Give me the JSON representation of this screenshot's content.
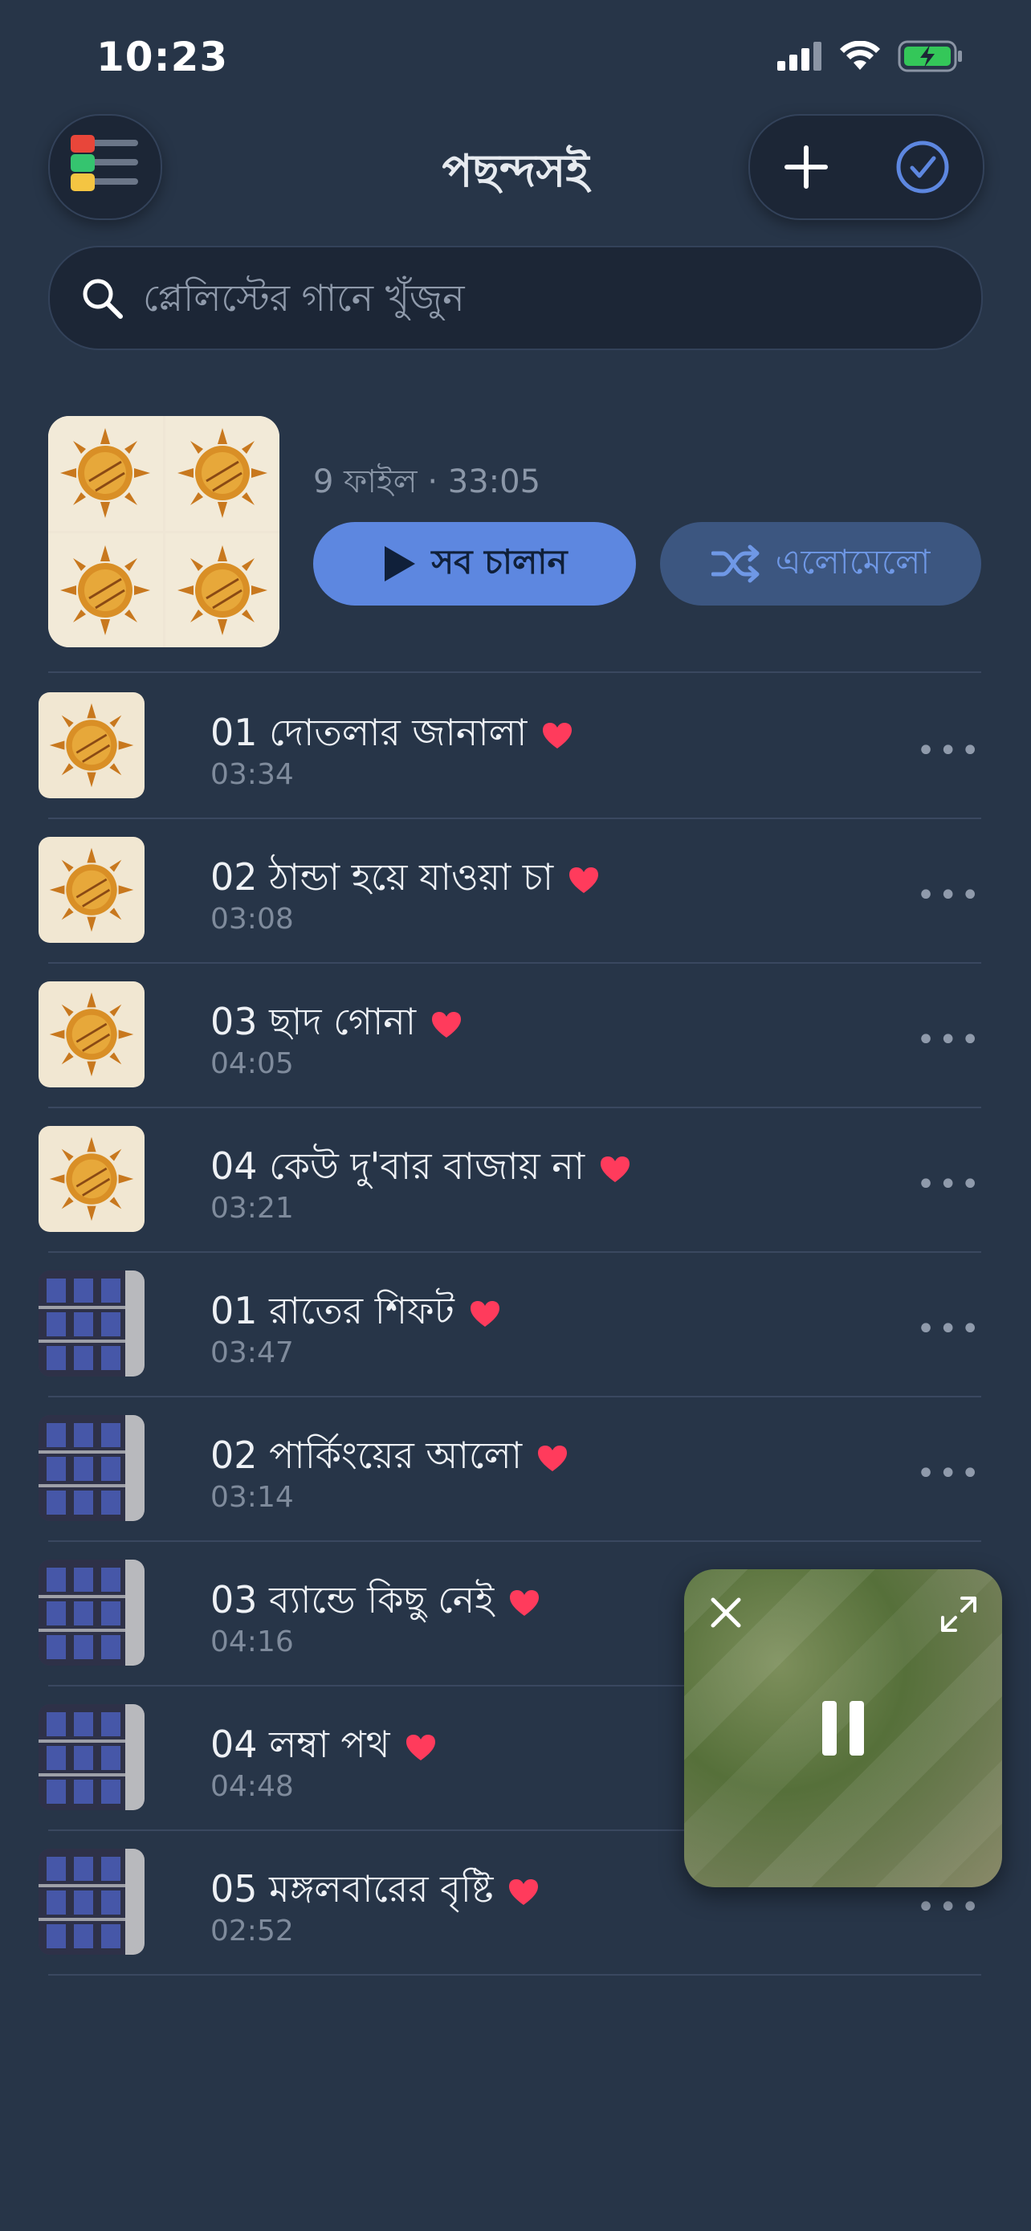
{
  "status": {
    "time": "10:23"
  },
  "header": {
    "title": "পছন্দসই"
  },
  "search": {
    "placeholder": "প্লেলিস্টের গানে খুঁজুন"
  },
  "playlist": {
    "meta": "9 ফাইল · 33:05",
    "play_all_label": "সব চালান",
    "shuffle_label": "এলোমেলো"
  },
  "songs": [
    {
      "title": "01 দোতলার জানালা",
      "duration": "03:34",
      "art": "sun",
      "favorite": true
    },
    {
      "title": "02 ঠান্ডা হয়ে যাওয়া চা",
      "duration": "03:08",
      "art": "sun",
      "favorite": true
    },
    {
      "title": "03 ছাদ গোনা",
      "duration": "04:05",
      "art": "sun",
      "favorite": true
    },
    {
      "title": "04 কেউ দু'বার বাজায় না",
      "duration": "03:21",
      "art": "sun",
      "favorite": true
    },
    {
      "title": "01 রাতের শিফট",
      "duration": "03:47",
      "art": "building",
      "favorite": true
    },
    {
      "title": "02 পার্কিংয়ের আলো",
      "duration": "03:14",
      "art": "building",
      "favorite": true
    },
    {
      "title": "03 ব্যান্ডে কিছু নেই",
      "duration": "04:16",
      "art": "building",
      "favorite": true
    },
    {
      "title": "04 লম্বা পথ",
      "duration": "04:48",
      "art": "building",
      "favorite": true
    },
    {
      "title": "05 মঙ্গলবারের বৃষ্টি",
      "duration": "02:52",
      "art": "building",
      "favorite": true
    }
  ],
  "colors": {
    "background": "#273548",
    "accent": "#5d87e0",
    "heart": "#ff3b5c"
  },
  "icons": [
    "menu-icon",
    "plus-icon",
    "check-circle-icon",
    "search-icon",
    "play-icon",
    "shuffle-icon",
    "heart-icon",
    "more-icon",
    "close-icon",
    "expand-icon",
    "pause-icon"
  ],
  "mini_player": {
    "state": "playing"
  }
}
